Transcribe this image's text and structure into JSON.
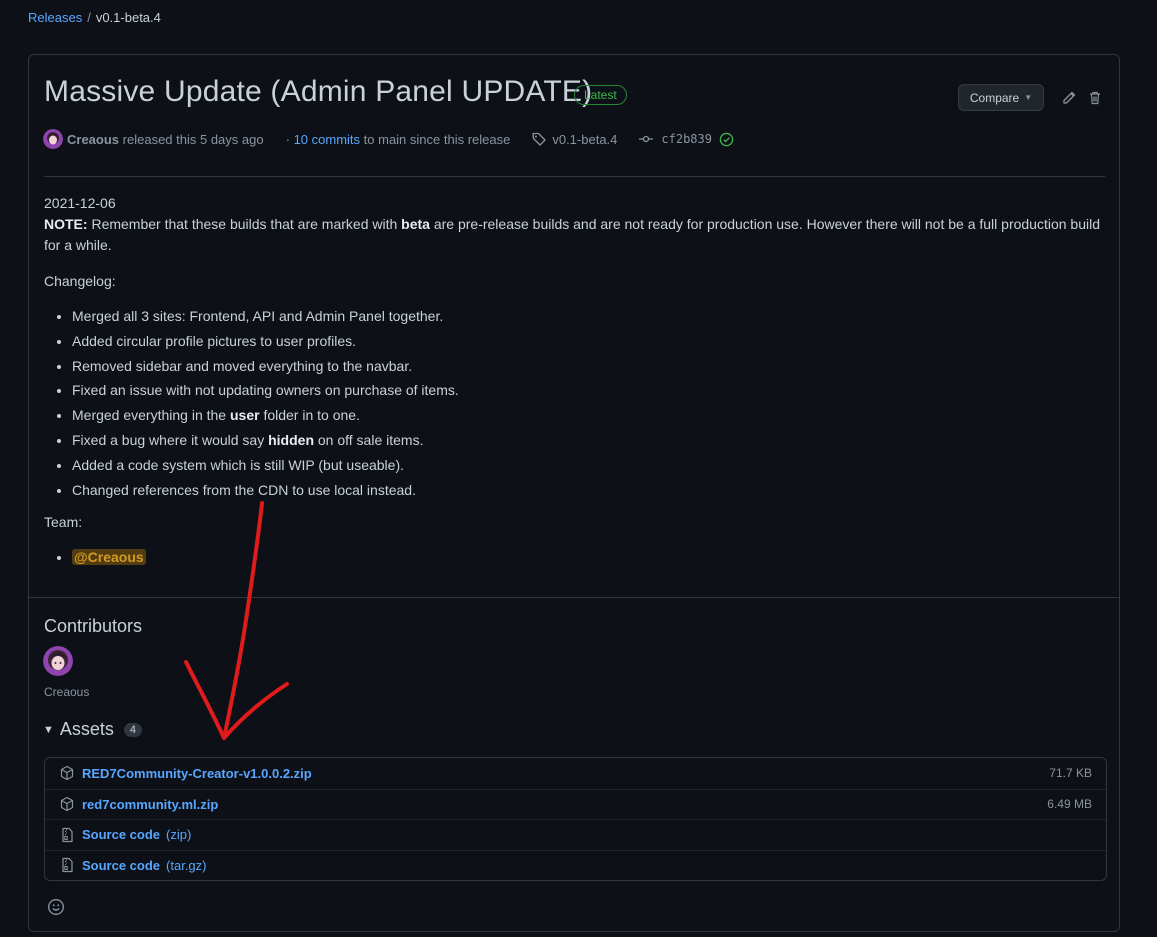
{
  "breadcrumb": {
    "root": "Releases",
    "separator": "/",
    "current": "v0.1-beta.4"
  },
  "release": {
    "title": "Massive Update (Admin Panel UPDATE)",
    "badge": "Latest",
    "compare_label": "Compare",
    "author": "Creaous",
    "released_text": "released this 5 days ago",
    "dot": "·",
    "commits_link": "10 commits",
    "commits_suffix": "to main since this release",
    "tag": "v0.1-beta.4",
    "commit_sha": "cf2b839"
  },
  "body": {
    "date": "2021-12-06",
    "note_label": "NOTE:",
    "note_part1": " Remember that these builds that are marked with ",
    "note_bold": "beta",
    "note_part2": " are pre-release builds and are not ready for production use. However there will not be a full production build for a while.",
    "changelog_heading": "Changelog:",
    "changelog": [
      {
        "pre": "Merged all 3 sites: Frontend, API and Admin Panel together.",
        "bold": "",
        "post": ""
      },
      {
        "pre": "Added circular profile pictures to user profiles.",
        "bold": "",
        "post": ""
      },
      {
        "pre": "Removed sidebar and moved everything to the navbar.",
        "bold": "",
        "post": ""
      },
      {
        "pre": "Fixed an issue with not updating owners on purchase of items.",
        "bold": "",
        "post": ""
      },
      {
        "pre": "Merged everything in the ",
        "bold": "user",
        "post": " folder in to one."
      },
      {
        "pre": "Fixed a bug where it would say ",
        "bold": "hidden",
        "post": " on off sale items."
      },
      {
        "pre": "Added a code system which is still WIP (but useable).",
        "bold": "",
        "post": ""
      },
      {
        "pre": "Changed references from the CDN to use local instead.",
        "bold": "",
        "post": ""
      }
    ],
    "team_heading": "Team:",
    "team": [
      "@Creaous"
    ]
  },
  "contributors": {
    "heading": "Contributors",
    "names": [
      "Creaous"
    ]
  },
  "assets": {
    "heading": "Assets",
    "count": "4",
    "items": [
      {
        "name": "RED7Community-Creator-v1.0.0.2.zip",
        "ext": "",
        "size": "71.7 KB",
        "icon": "package-icon"
      },
      {
        "name": "red7community.ml.zip",
        "ext": "",
        "size": "6.49 MB",
        "icon": "package-icon"
      },
      {
        "name": "Source code",
        "ext": "(zip)",
        "size": "",
        "icon": "file-zip-icon"
      },
      {
        "name": "Source code",
        "ext": "(tar.gz)",
        "size": "",
        "icon": "file-zip-icon"
      }
    ]
  },
  "colors": {
    "background": "#0d1117",
    "link": "#58a6ff",
    "border": "#30363d",
    "latest": "#3fb950",
    "annotation": "#e01b1b"
  }
}
